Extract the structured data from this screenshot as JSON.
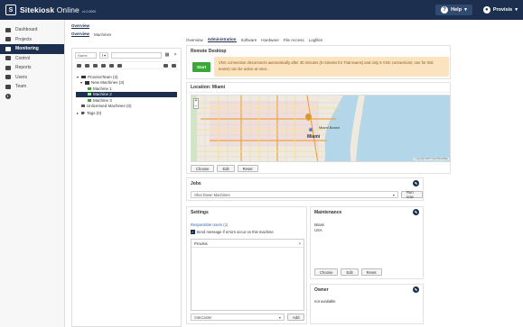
{
  "app": {
    "brand_bold": "Sitekiosk",
    "brand_thin": "Online",
    "version": "v1.0.0000",
    "help_label": "Help",
    "user_label": "Provisis"
  },
  "sidebar": {
    "items": [
      {
        "label": "Dashboard"
      },
      {
        "label": "Projects"
      },
      {
        "label": "Monitoring"
      },
      {
        "label": "Control"
      },
      {
        "label": "Reports"
      },
      {
        "label": "Users"
      },
      {
        "label": "Team"
      }
    ]
  },
  "top_tabs": {
    "overview": "Overview"
  },
  "sub_tabs": {
    "overview": "Overview",
    "machines": "Machines"
  },
  "filter": {
    "name_label": "Name",
    "mode_label": "Ⅰ ▾"
  },
  "tree": {
    "root": "ProvisisTeam (3)",
    "group": "New Machines (3)",
    "m1": "Machine 1",
    "m2": "Machine 2",
    "m3": "Machine 3",
    "unlicensed": "Unlicensed Machines (0)",
    "tags": "Tags (0)"
  },
  "detail_tabs": [
    "Overview",
    "Administration",
    "Software",
    "Hardware",
    "File Access",
    "Logfiles"
  ],
  "remote": {
    "title": "Remote Desktop",
    "start_label": "Start",
    "warning": "VNC connection disconnects automatically after 30 minutes (5 minutes for Trial teams) and only 5 VNC connections; one for trial teams) can be active at once."
  },
  "location": {
    "title": "Location: Miami",
    "city_label": "Miami",
    "beach_label": "Miami Beach",
    "attribution": "Copyright 2021 OpenStreetMap",
    "choose_label": "Choose",
    "edit_label": "Edit",
    "reset_label": "Reset"
  },
  "jobs": {
    "title": "Jobs",
    "select_value": "Shut Down Machines",
    "run_label": "Run now"
  },
  "settings": {
    "title": "Settings",
    "responsible_link": "Responsible Users (1)",
    "send_message": "Send message if errors occur on this machine",
    "user_item": "Provisis",
    "bottom_select": "SiteCaster",
    "add_label": "Add"
  },
  "maintenance": {
    "title": "Maintenance",
    "line1": "Miami",
    "line2": "USA",
    "choose_label": "Choose",
    "edit_label": "Edit",
    "reset_label": "Reset"
  },
  "owner": {
    "title": "Owner",
    "value": "not available"
  }
}
